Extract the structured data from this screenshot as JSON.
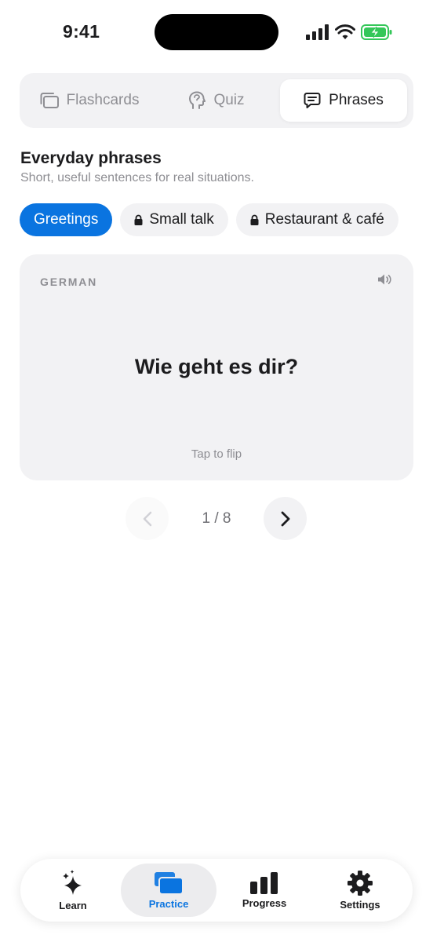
{
  "status_bar": {
    "time": "9:41"
  },
  "segments": [
    {
      "label": "Flashcards",
      "icon": "flashcards-icon",
      "active": false
    },
    {
      "label": "Quiz",
      "icon": "head-icon",
      "active": false
    },
    {
      "label": "Phrases",
      "icon": "chat-icon",
      "active": true
    }
  ],
  "section": {
    "title": "Everyday phrases",
    "subtitle": "Short, useful sentences for real situations."
  },
  "chips": [
    {
      "label": "Greetings",
      "locked": false,
      "active": true
    },
    {
      "label": "Small talk",
      "locked": true,
      "active": false
    },
    {
      "label": "Restaurant & café",
      "locked": true,
      "active": false
    }
  ],
  "card": {
    "language": "GERMAN",
    "phrase": "Wie geht es dir?",
    "hint": "Tap to flip"
  },
  "pager": {
    "count": "1 / 8"
  },
  "tabs": [
    {
      "label": "Learn",
      "icon": "sparkles-icon",
      "active": false
    },
    {
      "label": "Practice",
      "icon": "cards-icon",
      "active": true
    },
    {
      "label": "Progress",
      "icon": "bar-chart-icon",
      "active": false
    },
    {
      "label": "Settings",
      "icon": "gear-icon",
      "active": false
    }
  ],
  "colors": {
    "accent": "#0a74e0",
    "surface": "#f2f2f4",
    "text_primary": "#1c1c1e",
    "text_secondary": "#8e8e93",
    "battery": "#34c759"
  }
}
